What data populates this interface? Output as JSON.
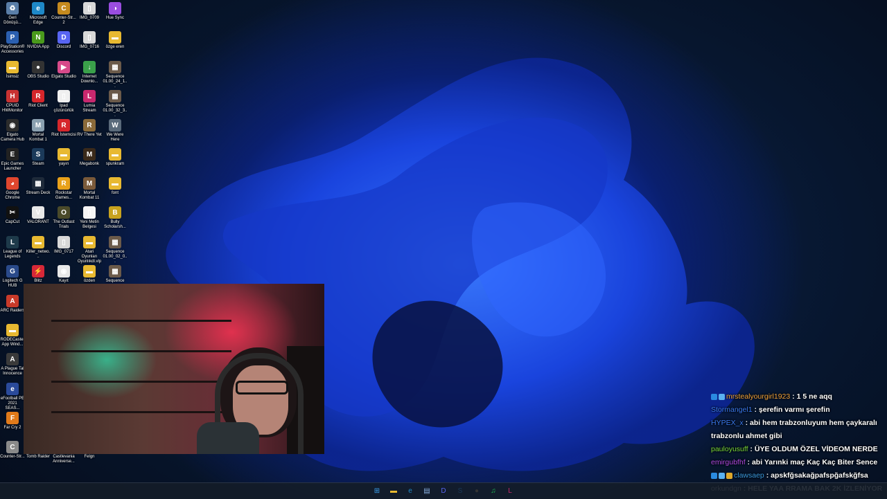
{
  "desktop_icons": [
    {
      "label": "Geri Dönüşü...",
      "icon": "recycle-bin-icon",
      "color": "#5a7ea8",
      "glyph": "♻"
    },
    {
      "label": "Microsoft Edge",
      "icon": "edge-icon",
      "color": "#1e88c8",
      "glyph": "e"
    },
    {
      "label": "Counter-Str... 2",
      "icon": "cs2-icon",
      "color": "#c58a1e",
      "glyph": "C"
    },
    {
      "label": "IMG_0709",
      "icon": "file-icon",
      "color": "#d8d8d8",
      "glyph": "▯"
    },
    {
      "label": "Hue Sync",
      "icon": "hue-sync-icon",
      "color": "#9a4de0",
      "glyph": "◑"
    },
    {
      "label": "PlayStation® Accessories",
      "icon": "playstation-icon",
      "color": "#2b5fb0",
      "glyph": "P"
    },
    {
      "label": "NVIDIA App",
      "icon": "nvidia-icon",
      "color": "#4a9a1c",
      "glyph": "N"
    },
    {
      "label": "Discord",
      "icon": "discord-icon",
      "color": "#5865f2",
      "glyph": "D"
    },
    {
      "label": "IMG_0716",
      "icon": "file-icon",
      "color": "#d8d8d8",
      "glyph": "▯"
    },
    {
      "label": "özge eren",
      "icon": "folder-icon",
      "color": "#e8b931",
      "glyph": "▬"
    },
    {
      "label": "İsimsiz",
      "icon": "folder-icon",
      "color": "#e8b931",
      "glyph": "▬"
    },
    {
      "label": "OBS Studio",
      "icon": "obs-icon",
      "color": "#333333",
      "glyph": "●"
    },
    {
      "label": "Elgato Studio",
      "icon": "elgato-studio-icon",
      "color": "#d84a8a",
      "glyph": "▶"
    },
    {
      "label": "Internet Downlo...",
      "icon": "idm-icon",
      "color": "#3aa04a",
      "glyph": "↓"
    },
    {
      "label": "Sequence 01.00_24_1...",
      "icon": "video-thumb-icon",
      "color": "#6b5a4a",
      "glyph": "▦"
    },
    {
      "label": "CPUID HWMonitor",
      "icon": "hwmonitor-icon",
      "color": "#c83232",
      "glyph": "H"
    },
    {
      "label": "Riot Client",
      "icon": "riot-client-icon",
      "color": "#d6262b",
      "glyph": "R"
    },
    {
      "label": "Ipad çözünürlük",
      "icon": "file-icon",
      "color": "#f0f0f0",
      "glyph": "▯"
    },
    {
      "label": "Lumia Stream",
      "icon": "lumia-icon",
      "color": "#c8286e",
      "glyph": "L"
    },
    {
      "label": "Sequence 01.00_32_3...",
      "icon": "video-thumb-icon",
      "color": "#6b5a4a",
      "glyph": "▦"
    },
    {
      "label": "Elgato Camera Hub",
      "icon": "camera-hub-icon",
      "color": "#2c2c2c",
      "glyph": "◉"
    },
    {
      "label": "Mortal Kombat 1",
      "icon": "mk1-icon",
      "color": "#8aa0b0",
      "glyph": "M"
    },
    {
      "label": "Riot İstemcisi",
      "icon": "riot-client-icon",
      "color": "#d6262b",
      "glyph": "R"
    },
    {
      "label": "RV There Yet",
      "icon": "rv-there-yet-icon",
      "color": "#8a6a3a",
      "glyph": "R"
    },
    {
      "label": "We Were Here",
      "icon": "we-were-here-icon",
      "color": "#5a6a7a",
      "glyph": "W"
    },
    {
      "label": "Epic Games Launcher",
      "icon": "epic-games-icon",
      "color": "#222222",
      "glyph": "E"
    },
    {
      "label": "Steam",
      "icon": "steam-icon",
      "color": "#1b3a5a",
      "glyph": "S"
    },
    {
      "label": "yayın",
      "icon": "folder-icon",
      "color": "#e8b931",
      "glyph": "▬"
    },
    {
      "label": "Megabonk",
      "icon": "megabonk-icon",
      "color": "#3a2a1a",
      "glyph": "M"
    },
    {
      "label": "spunkram",
      "icon": "folder-icon",
      "color": "#e8b931",
      "glyph": "▬"
    },
    {
      "label": "Google Chrome",
      "icon": "chrome-icon",
      "color": "#e0462e",
      "glyph": "◕"
    },
    {
      "label": "Stream Deck",
      "icon": "stream-deck-icon",
      "color": "#1e2a3a",
      "glyph": "▦"
    },
    {
      "label": "Rockstar Games...",
      "icon": "rockstar-icon",
      "color": "#e8a11a",
      "glyph": "R"
    },
    {
      "label": "Mortal Kombat 11",
      "icon": "mk11-icon",
      "color": "#7a5a3a",
      "glyph": "M"
    },
    {
      "label": "font",
      "icon": "folder-icon",
      "color": "#e8b931",
      "glyph": "▬"
    },
    {
      "label": "CapCut",
      "icon": "capcut-icon",
      "color": "#111111",
      "glyph": "✂"
    },
    {
      "label": "VALORANT",
      "icon": "valorant-icon",
      "color": "#e8e8e8",
      "glyph": "V"
    },
    {
      "label": "The Outlast Trials",
      "icon": "outlast-icon",
      "color": "#4a4a2a",
      "glyph": "O"
    },
    {
      "label": "Yeni Metin Belgesi",
      "icon": "text-file-icon",
      "color": "#f5f5f5",
      "glyph": "▯"
    },
    {
      "label": "Bully Scholarsh...",
      "icon": "bully-icon",
      "color": "#c8a21e",
      "glyph": "B"
    },
    {
      "label": "League of Legends",
      "icon": "lol-icon",
      "color": "#1e3a4a",
      "glyph": "L"
    },
    {
      "label": "Killer_netwo...",
      "icon": "folder-icon",
      "color": "#e8b931",
      "glyph": "▬"
    },
    {
      "label": "IMG_0717",
      "icon": "file-icon",
      "color": "#d8d8d8",
      "glyph": "▯"
    },
    {
      "label": "Atari Oyunları Oyunlıkdl.vlp",
      "icon": "folder-icon",
      "color": "#e8b931",
      "glyph": "▬"
    },
    {
      "label": "Sequence 01.00_02_0...",
      "icon": "video-thumb-icon",
      "color": "#6b5a4a",
      "glyph": "▦"
    },
    {
      "label": "Logitech G HUB",
      "icon": "ghub-icon",
      "color": "#2a4a8a",
      "glyph": "G"
    },
    {
      "label": "Blitz",
      "icon": "blitz-icon",
      "color": "#d62838",
      "glyph": "⚡"
    },
    {
      "label": "Kayıt",
      "icon": "kayit-icon",
      "color": "#e8e8e8",
      "glyph": "◉"
    },
    {
      "label": "özden",
      "icon": "folder-icon",
      "color": "#e8b931",
      "glyph": "▬"
    },
    {
      "label": "Sequence",
      "icon": "video-thumb-icon",
      "color": "#6b5a4a",
      "glyph": "▦"
    },
    {
      "label": "ARC Raiders",
      "icon": "arc-raiders-icon",
      "color": "#c83a2a",
      "glyph": "A"
    },
    {
      "label": "RODECaster App Wind...",
      "icon": "folder-icon",
      "color": "#e8b931",
      "glyph": "▬"
    },
    {
      "label": "A Plague Tal Innocence",
      "icon": "plague-tale-icon",
      "color": "#3a3a3a",
      "glyph": "A"
    },
    {
      "label": "eFootball PE 2021 SEAS...",
      "icon": "efootball-icon",
      "color": "#2a4a9a",
      "glyph": "e"
    },
    {
      "label": "Far Cry 2",
      "icon": "far-cry-icon",
      "color": "#e07a1a",
      "glyph": "F"
    },
    {
      "label": "Counter-Str...",
      "icon": "cs-icon",
      "color": "#8a8a8a",
      "glyph": "C"
    },
    {
      "label": "Tomb Raider",
      "icon": "tomb-raider-icon",
      "color": "#5a4a3a",
      "glyph": "T"
    },
    {
      "label": "Castlevania Anniverse...",
      "icon": "castlevania-icon",
      "color": "#4a2a3a",
      "glyph": "C"
    },
    {
      "label": "Felgn",
      "icon": "felgn-icon",
      "color": "#3a3a3a",
      "glyph": "F"
    }
  ],
  "chat": [
    {
      "user": "mrstealyourgirl1923",
      "user_color": "#f0a23a",
      "badges": [
        "#2a8ae0",
        "#5ab0f0"
      ],
      "text": "1 5 ne aqq"
    },
    {
      "user": "Stormangel1",
      "user_color": "#3a7af0",
      "badges": [],
      "text": "şerefin varmı şerefin"
    },
    {
      "user": "HYPEX_x",
      "user_color": "#3a7af0",
      "badges": [],
      "text": "abi hem trabzonluyum hem çaykaralı trabzonlu ahmet gibi"
    },
    {
      "user": "pauloyusuff",
      "user_color": "#7ad83a",
      "badges": [],
      "text": "ÜYE OLDUM ÖZEL VİDEOM NERDE"
    },
    {
      "user": "emirgubfhf",
      "user_color": "#b04ae0",
      "badges": [],
      "text": "abi Yarınki maç Kaç Kaç Biter Sence"
    },
    {
      "user": "clawsaep",
      "user_color": "#3a9ae0",
      "badges": [
        "#2a8ae0",
        "#5ab0f0",
        "#e0a82a"
      ],
      "text": "apskfğsakağpafspğafskğfsa"
    },
    {
      "user": "orkundgn",
      "user_color": "#ffffff",
      "badges": [],
      "text": "HELE YAA RRAMA BAK 2K İZLENİYOR"
    }
  ],
  "taskbar": [
    {
      "icon": "start-icon",
      "glyph": "⊞",
      "color": "#3aa0f0"
    },
    {
      "icon": "file-explorer-icon",
      "glyph": "▬",
      "color": "#e8b931"
    },
    {
      "icon": "edge-icon",
      "glyph": "e",
      "color": "#1e88c8"
    },
    {
      "icon": "notepad-icon",
      "glyph": "▤",
      "color": "#8ab0e0"
    },
    {
      "icon": "discord-icon",
      "glyph": "D",
      "color": "#5865f2"
    },
    {
      "icon": "steam-icon",
      "glyph": "S",
      "color": "#1b3a5a"
    },
    {
      "icon": "obs-icon",
      "glyph": "●",
      "color": "#333333"
    },
    {
      "icon": "spotify-icon",
      "glyph": "♫",
      "color": "#1db954"
    },
    {
      "icon": "lumia-icon",
      "glyph": "L",
      "color": "#c8286e"
    }
  ]
}
